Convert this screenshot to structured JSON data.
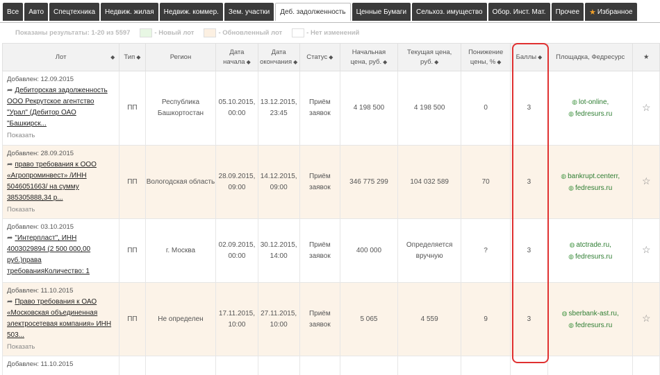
{
  "tabs": [
    {
      "label": "Все",
      "active": false
    },
    {
      "label": "Авто",
      "active": false
    },
    {
      "label": "Спецтехника",
      "active": false
    },
    {
      "label": "Недвиж. жилая",
      "active": false
    },
    {
      "label": "Недвиж. коммер.",
      "active": false
    },
    {
      "label": "Зем. участки",
      "active": false
    },
    {
      "label": "Деб. задолженность",
      "active": true
    },
    {
      "label": "Ценные Бумаги",
      "active": false
    },
    {
      "label": "Сельхоз. имущество",
      "active": false
    },
    {
      "label": "Обор. Инст. Мат.",
      "active": false
    },
    {
      "label": "Прочее",
      "active": false
    },
    {
      "label": "Избранное",
      "active": false
    }
  ],
  "results_text": "Показаны результаты: 1-20 из 5597",
  "legend": [
    {
      "label": "- Новый лот",
      "color": "#e8f7e4"
    },
    {
      "label": "- Обновленный лот",
      "color": "#fcf0e2"
    },
    {
      "label": "- Нет изменений",
      "color": "#ffffff"
    }
  ],
  "columns": {
    "lot": "Лот",
    "type": "Тип",
    "region": "Регион",
    "start_1": "Дата",
    "start_2": "начала",
    "end_1": "Дата",
    "end_2": "окончания",
    "status": "Статус",
    "initial_1": "Начальная",
    "initial_2": "цена, руб.",
    "current_1": "Текущая цена,",
    "current_2": "руб.",
    "drop_1": "Понижение",
    "drop_2": "цены, %",
    "score": "Баллы",
    "site": "Площадка, Федресурс",
    "fav": "★"
  },
  "rows": [
    {
      "added": "Добавлен: 12.09.2015",
      "title": "Дебиторская задолженность ООО Рекрутское агентство \"Урал\" (Дебитор ОАО \"Башкирск...",
      "show": "Показать",
      "type": "ПП",
      "region": "Республика Башкортостан",
      "start_date": "05.10.2015,",
      "start_time": "00:00",
      "end_date": "13.12.2015,",
      "end_time": "23:45",
      "status_1": "Приём",
      "status_2": "заявок",
      "initial": "4 198 500",
      "current": "4 198 500",
      "drop": "0",
      "score": "3",
      "site_1": "lot-online,",
      "site_2": "fedresurs.ru"
    },
    {
      "added": "Добавлен: 28.09.2015",
      "title": "право требования к ООО «Агропроминвест» /ИНН 5046051663/ на сумму 385305888,34 р...",
      "show": "Показать",
      "type": "ПП",
      "region": "Вологодская область",
      "start_date": "28.09.2015,",
      "start_time": "09:00",
      "end_date": "14.12.2015,",
      "end_time": "09:00",
      "status_1": "Приём",
      "status_2": "заявок",
      "initial": "346 775 299",
      "current": "104 032 589",
      "drop": "70",
      "score": "3",
      "site_1": "bankrupt.centerr,",
      "site_2": "fedresurs.ru"
    },
    {
      "added": "Добавлен: 03.10.2015",
      "title": "\"Интерпласт\", ИНН 4003029894 (2 500 000,00 руб.)права требованияКоличество: 1",
      "show": "",
      "type": "ПП",
      "region": "г. Москва",
      "start_date": "02.09.2015,",
      "start_time": "00:00",
      "end_date": "30.12.2015,",
      "end_time": "14:00",
      "status_1": "Приём",
      "status_2": "заявок",
      "initial": "400 000",
      "current": "Определяется вручную",
      "drop": "?",
      "score": "3",
      "site_1": "atctrade.ru,",
      "site_2": "fedresurs.ru"
    },
    {
      "added": "Добавлен: 11.10.2015",
      "title": "Право требования к ОАО «Московская объединенная электросетевая компания» ИНН 503...",
      "show": "Показать",
      "type": "ПП",
      "region": "Не определен",
      "start_date": "17.11.2015,",
      "start_time": "10:00",
      "end_date": "27.11.2015,",
      "end_time": "10:00",
      "status_1": "Приём",
      "status_2": "заявок",
      "initial": "5 065",
      "current": "4 559",
      "drop": "9",
      "score": "3",
      "site_1": "sberbank-ast.ru,",
      "site_2": "fedresurs.ru"
    },
    {
      "added": "Добавлен: 11.10.2015"
    }
  ]
}
